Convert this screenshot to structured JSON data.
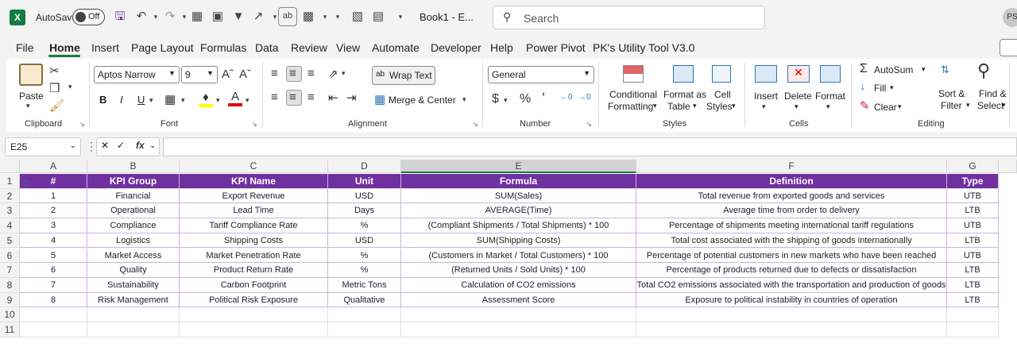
{
  "titlebar": {
    "autosave_label": "AutoSave",
    "autosave_state": "Off",
    "doc_title": "Book1 - E...",
    "search_placeholder": "Search",
    "avatar": "PS"
  },
  "menu": {
    "tabs": [
      "File",
      "Home",
      "Insert",
      "Page Layout",
      "Formulas",
      "Data",
      "Review",
      "View",
      "Automate",
      "Developer",
      "Help",
      "Power Pivot",
      "PK's Utility Tool V3.0"
    ],
    "active": "Home"
  },
  "ribbon": {
    "clipboard": {
      "paste": "Paste",
      "label": "Clipboard"
    },
    "font": {
      "name": "Aptos Narrow",
      "size": "9",
      "label": "Font",
      "bold": "B",
      "italic": "I",
      "underline": "U"
    },
    "alignment": {
      "wrap_text": "Wrap Text",
      "merge_center": "Merge & Center",
      "label": "Alignment"
    },
    "number": {
      "format": "General",
      "label": "Number"
    },
    "styles": {
      "conditional_1": "Conditional",
      "conditional_2": "Formatting",
      "format_as_1": "Format as",
      "format_as_2": "Table",
      "cell_1": "Cell",
      "cell_2": "Styles",
      "label": "Styles"
    },
    "cells": {
      "insert": "Insert",
      "delete": "Delete",
      "format": "Format",
      "label": "Cells"
    },
    "editing": {
      "autosum": "AutoSum",
      "fill": "Fill",
      "clear": "Clear",
      "sort_1": "Sort &",
      "sort_2": "Filter",
      "find_1": "Find &",
      "find_2": "Select",
      "label": "Editing"
    }
  },
  "formula_bar": {
    "name_box": "E25",
    "fx": "fx",
    "value": ""
  },
  "sheet": {
    "columns": [
      "A",
      "B",
      "C",
      "D",
      "E",
      "F",
      "G"
    ],
    "rows": [
      "1",
      "2",
      "3",
      "4",
      "5",
      "6",
      "7",
      "8",
      "9",
      "10",
      "11"
    ],
    "header": [
      "#",
      "KPI Group",
      "KPI Name",
      "Unit",
      "Formula",
      "Definition",
      "Type"
    ],
    "data": [
      [
        "1",
        "Financial",
        "Export Revenue",
        "USD",
        "SUM(Sales)",
        "Total revenue from exported goods and services",
        "UTB"
      ],
      [
        "2",
        "Operational",
        "Lead Time",
        "Days",
        "AVERAGE(Time)",
        "Average time from order to delivery",
        "LTB"
      ],
      [
        "3",
        "Compliance",
        "Tariff Compliance Rate",
        "%",
        "(Compliant Shipments / Total Shipments) * 100",
        "Percentage of shipments meeting international tariff regulations",
        "UTB"
      ],
      [
        "4",
        "Logistics",
        "Shipping Costs",
        "USD",
        "SUM(Shipping Costs)",
        "Total cost associated with the shipping of goods internationally",
        "LTB"
      ],
      [
        "5",
        "Market Access",
        "Market Penetration Rate",
        "%",
        "(Customers in Market / Total Customers) * 100",
        "Percentage of potential customers in new markets who have been reached",
        "UTB"
      ],
      [
        "6",
        "Quality",
        "Product Return Rate",
        "%",
        "(Returned Units / Sold Units) * 100",
        "Percentage of products returned due to defects or dissatisfaction",
        "LTB"
      ],
      [
        "7",
        "Sustainability",
        "Carbon Footprint",
        "Metric Tons",
        "Calculation of CO2 emissions",
        "Total CO2 emissions associated with the transportation and production of goods",
        "LTB"
      ],
      [
        "8",
        "Risk Management",
        "Political Risk Exposure",
        "Qualitative",
        "Assessment Score",
        "Exposure to political instability in countries of operation",
        "LTB"
      ]
    ],
    "header_color": "#7030a0",
    "accent": "#107c41"
  }
}
